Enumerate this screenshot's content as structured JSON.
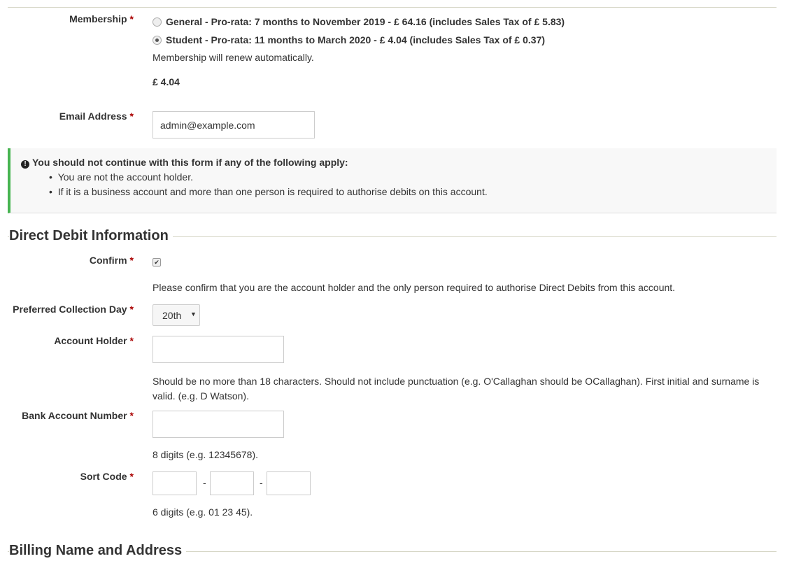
{
  "membership": {
    "label": "Membership",
    "required": "*",
    "options": [
      {
        "label": "General - Pro-rata: 7 months to November 2019 - £ 64.16 (includes Sales Tax of £ 5.83)",
        "selected": false
      },
      {
        "label": "Student - Pro-rata: 11 months to March 2020 - £ 4.04 (includes Sales Tax of £ 0.37)",
        "selected": true
      }
    ],
    "renew_note": "Membership will renew automatically.",
    "total": "£ 4.04"
  },
  "email": {
    "label": "Email Address",
    "required": "*",
    "value": "admin@example.com"
  },
  "alert": {
    "icon": "exclamation-circle-icon",
    "title": "You should not continue with this form if any of the following apply:",
    "items": [
      "You are not the account holder.",
      "If it is a business account and more than one person is required to authorise debits on this account."
    ],
    "accent": "#46b450"
  },
  "direct_debit": {
    "heading": "Direct Debit Information",
    "confirm": {
      "label": "Confirm",
      "required": "*",
      "checked": true,
      "help": "Please confirm that you are the account holder and the only person required to authorise Direct Debits from this account."
    },
    "collection_day": {
      "label": "Preferred Collection Day",
      "required": "*",
      "value": "20th"
    },
    "account_holder": {
      "label": "Account Holder",
      "required": "*",
      "value": "",
      "help": "Should be no more than 18 characters. Should not include punctuation (e.g. O'Callaghan should be OCallaghan). First initial and surname is valid. (e.g. D Watson)."
    },
    "account_number": {
      "label": "Bank Account Number",
      "required": "*",
      "value": "",
      "help": "8 digits (e.g. 12345678)."
    },
    "sort_code": {
      "label": "Sort Code",
      "required": "*",
      "separator": "-",
      "help": "6 digits (e.g. 01 23 45)."
    }
  },
  "billing": {
    "heading": "Billing Name and Address"
  }
}
